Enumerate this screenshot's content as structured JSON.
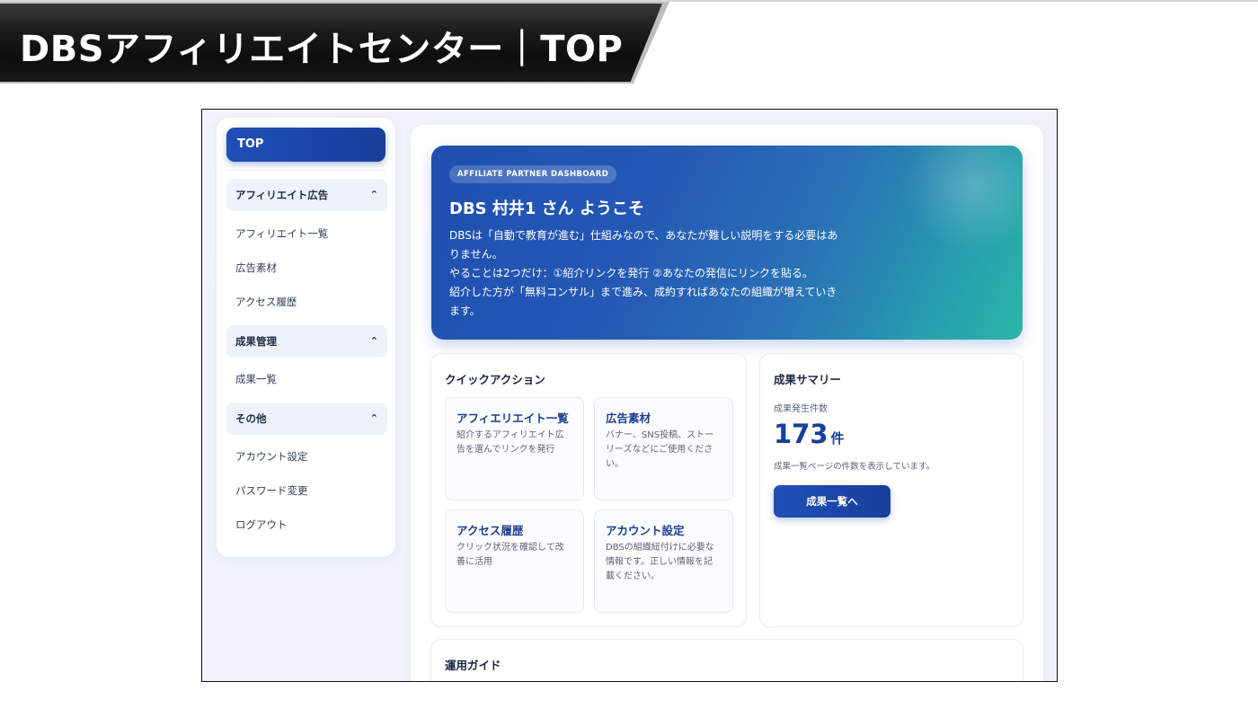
{
  "banner": {
    "title": "DBSアフィリエイトセンター｜TOP"
  },
  "sidebar": {
    "top_label": "TOP",
    "groups": [
      {
        "label": "アフィリエイト広告",
        "chevron": "chevron-up-icon",
        "items": [
          "アフィリエイト一覧",
          "広告素材",
          "アクセス履歴"
        ]
      },
      {
        "label": "成果管理",
        "chevron": "chevron-up-icon",
        "items": [
          "成果一覧"
        ]
      },
      {
        "label": "その他",
        "chevron": "chevron-up-icon",
        "items": [
          "アカウント設定",
          "パスワード変更",
          "ログアウト"
        ]
      }
    ]
  },
  "hero": {
    "badge": "AFFILIATE PARTNER DASHBOARD",
    "title": "DBS 村井1 さん ようこそ",
    "lines": [
      "DBSは「自動で教育が進む」仕組みなので、あなたが難しい説明をする必要はあ",
      "りません。",
      "やることは2つだけ：①紹介リンクを発行 ②あなたの発信にリンクを貼る。",
      "紹介した方が「無料コンサル」まで進み、成約すればあなたの組織が増えていき",
      "ます。"
    ]
  },
  "quick_actions": {
    "title": "クイックアクション",
    "tiles": [
      {
        "title": "アフィエリエイト一覧",
        "lines": [
          "紹介するアフィリエイト広",
          "告を選んでリンクを発行"
        ]
      },
      {
        "title": "広告素材",
        "lines": [
          "バナー、SNS投稿、ストー",
          "リーズなどにご使用くださ",
          "い。"
        ]
      },
      {
        "title": "アクセス履歴",
        "lines": [
          "クリック状況を確認して改",
          "善に活用"
        ]
      },
      {
        "title": "アカウント設定",
        "lines": [
          "DBSの組織紐付けに必要な",
          "情報です。正しい情報を記",
          "載ください。"
        ]
      }
    ]
  },
  "summary": {
    "title": "成果サマリー",
    "label": "成果発生件数",
    "count": "173",
    "unit": "件",
    "note": "成果一覧ページの件数を表示しています。",
    "button": "成果一覧へ"
  },
  "guide": {
    "title": "運用ガイド"
  },
  "colors": {
    "accent": "#1f4fb8",
    "hero_start": "#1f4fb0",
    "hero_end": "#2bb5a8"
  }
}
